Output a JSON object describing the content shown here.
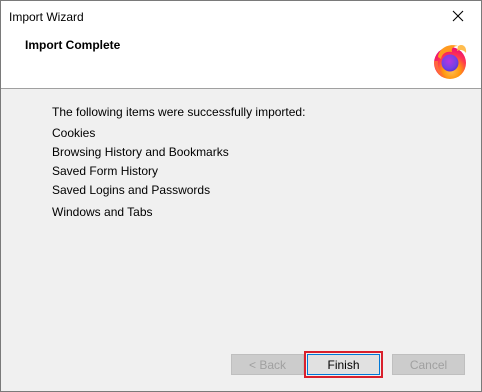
{
  "window": {
    "title": "Import Wizard",
    "close_glyph": "✕"
  },
  "header": {
    "heading": "Import Complete",
    "logo_icon": "firefox-logo"
  },
  "content": {
    "intro": "The following items were successfully imported:",
    "items": [
      "Cookies",
      "Browsing History and Bookmarks",
      "Saved Form History",
      "Saved Logins and Passwords",
      "Windows and Tabs"
    ]
  },
  "buttons": {
    "back": "< Back",
    "finish": "Finish",
    "cancel": "Cancel"
  },
  "colors": {
    "focus_highlight": "#d9202c",
    "dialog_background": "#f0f0f0"
  }
}
